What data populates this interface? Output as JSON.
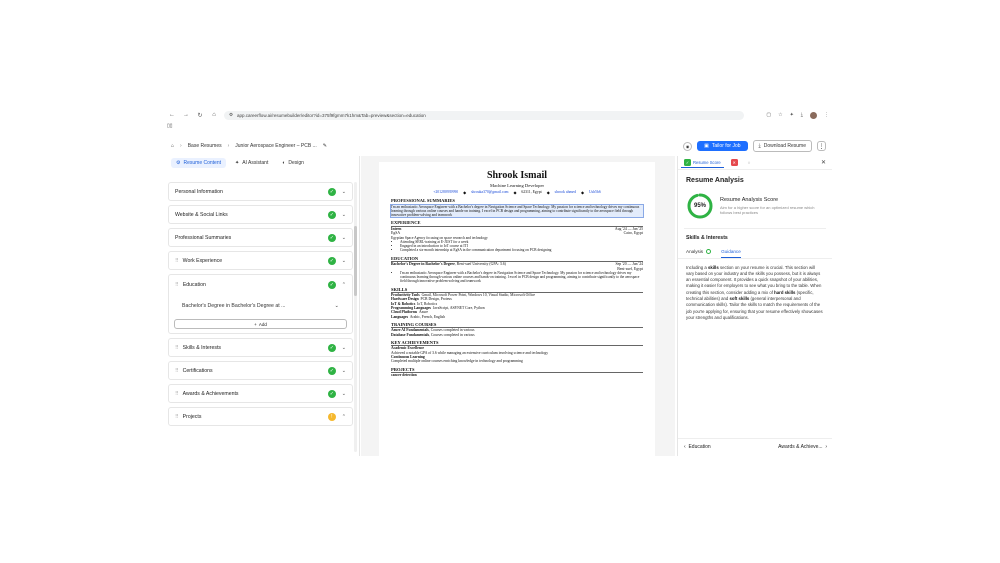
{
  "browser": {
    "url": "app.careerflow.ai/resumebuilder/editor?id=375f9fgmm7k1hm&Tab=preview&section=education"
  },
  "header": {
    "breadcrumb_root": "Base Resumes",
    "breadcrumb_current": "Junior Aerospace Engineer – PCB ...",
    "tailor_label": "Tailor for Job",
    "download_label": "Download Resume"
  },
  "left": {
    "tabs": [
      "Resume Content",
      "AI Assistant",
      "Design"
    ],
    "sections": {
      "personal": "Personal Information",
      "website": "Website & Social Links",
      "summary": "Professional Summaries",
      "work": "Work Experience",
      "education": "Education",
      "education_item": "Bachelor's Degree in Bachelor's Degree at ...",
      "add": "Add",
      "skills": "Skills & Interests",
      "certs": "Certifications",
      "awards": "Awards & Achievements",
      "projects": "Projects"
    }
  },
  "resume": {
    "name": "Shrook Ismail",
    "role": "Machine Learning Developer",
    "phone": "+201280939990",
    "email": "shrouka370@gmail.com",
    "location": "62311, Egypt",
    "linkedin": "shrook ahmed",
    "github": "Ush5b6",
    "summary_title": "PROFESSIONAL SUMMARIES",
    "summary": "I'm an enthusiastic Aerospace Engineer with a Bachelor's degree in Navigation Science and Space Technology. My passion for science and technology drives my continuous learning through various online courses and hands-on training. I excel in PCB design and programming, aiming to contribute significantly to the aerospace field through innovative problem-solving and teamwork",
    "exp_title": "EXPERIENCE",
    "exp_role": "Intern",
    "exp_dates": "Aug '24 — Jan '25",
    "exp_org": "EgSA",
    "exp_loc": "Cairo, Egypt",
    "exp_desc": "Egyptian Space Agency focusing on space research and technology",
    "exp_bullets": [
      "Attending SERL-training at E-JUST for a week",
      "Engaged in an introduction to IoT course at ITI",
      "Completed a six-month internship at EgSA in the communication department focusing on PCB designing"
    ],
    "edu_title": "EDUCATION",
    "edu_degree": "Bachelor's Degree in Bachelor's Degree",
    "edu_school": ", Beni-suef University (GPA: 3.6)",
    "edu_dates": "Sep '20 — Jun '24",
    "edu_loc": "Beni-suef, Egypt",
    "edu_bullet": "I'm an enthusiastic Aerospace Engineer with a Bachelor's degree in Navigation Science and Space Technology. My passion for science and technology drives my continuous learning through various online courses and hands-on training. I excel in PCB design and programming, aiming to contribute significantly to the aerospace field through innovative problem-solving and teamwork",
    "skills_title": "SKILLS",
    "skills": [
      {
        "k": "Productivity Tools",
        "v": "Gmail, Microsoft Power Point, Windows 10, Visual Studio, Microsoft Office"
      },
      {
        "k": "Hardware Design",
        "v": "PCB Design, Proteus"
      },
      {
        "k": "IoT & Robotics",
        "v": "IoT, Robotics"
      },
      {
        "k": "Programming Languages",
        "v": "JavaScript, ASP.NET Core, Python"
      },
      {
        "k": "Cloud Platforms",
        "v": "Azure"
      },
      {
        "k": "Languages",
        "v": "Arabic, French, English"
      }
    ],
    "training_title": "TRAINING COURSES",
    "training": [
      {
        "k": "Azure AI Fundamentals",
        "v": ", Courses completed in various"
      },
      {
        "k": "Database Fundamentals",
        "v": ", Courses completed in various"
      }
    ],
    "ach_title": "KEY ACHIEVEMENTS",
    "ach": [
      {
        "k": "Academic Excellence",
        "v": "Achieved a notable GPA of 3.6 while managing an extensive curriculum involving science and technology"
      },
      {
        "k": "Continuous Learning",
        "v": "Completed multiple online courses enriching knowledge in technology and programming"
      }
    ],
    "projects_title": "PROJECTS",
    "project_name": "cancer detection"
  },
  "right": {
    "tab_score": "Resume Score",
    "title": "Resume Analysis",
    "score": "95%",
    "score_value": 95,
    "score_title": "Resume Analysis Score",
    "score_sub": "Aim for a higher score for an optimized resume which follows best practices",
    "section": "Skills & Interests",
    "subtab_analysis": "Analysis",
    "subtab_guidance": "Guidance",
    "guidance": [
      {
        "t": "Including a ",
        "b": false
      },
      {
        "t": "skills",
        "b": true
      },
      {
        "t": " section on your resume is crucial. This section will vary based on your industry and the skills you possess, but it is always an essential component. It provides a quick snapshot of your abilities, making it easier for employers to see what you bring to the table. When creating this section, consider adding a mix of ",
        "b": false
      },
      {
        "t": "hard skills",
        "b": true
      },
      {
        "t": " (specific, technical abilities) and ",
        "b": false
      },
      {
        "t": "soft skills",
        "b": true
      },
      {
        "t": " (general interpersonal and communication skills). Tailor the skills to match the requirements of the job you're applying for, ensuring that your resume effectively showcases your strengths and qualifications.",
        "b": false
      }
    ],
    "prev": "Education",
    "next": "Awards & Achieve..."
  },
  "colors": {
    "accent": "#1e6fff",
    "success": "#2fb344",
    "warn": "#f5b82e"
  }
}
